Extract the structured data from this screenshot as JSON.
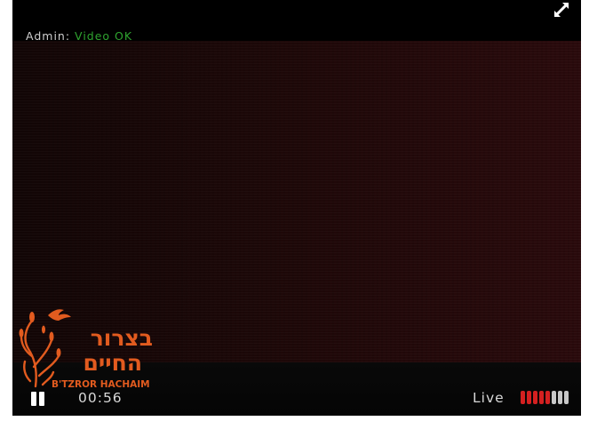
{
  "status": {
    "label": "Admin:",
    "value": "Video OK"
  },
  "player": {
    "elapsed": "00:56",
    "live_label": "Live",
    "volume_level": 0.6
  },
  "logo": {
    "hebrew_line1": "בצרור",
    "hebrew_line2": "החיים",
    "english": "B'TZROR HACHAIM"
  },
  "colors": {
    "status_ok": "#2fa32f",
    "logo_orange": "#e25b1f",
    "volume_active": "#d42020",
    "volume_inactive": "#c8c8c8"
  },
  "icons": {
    "fullscreen": "fullscreen-icon",
    "pause": "pause-icon",
    "volume": "volume-bars-icon"
  }
}
